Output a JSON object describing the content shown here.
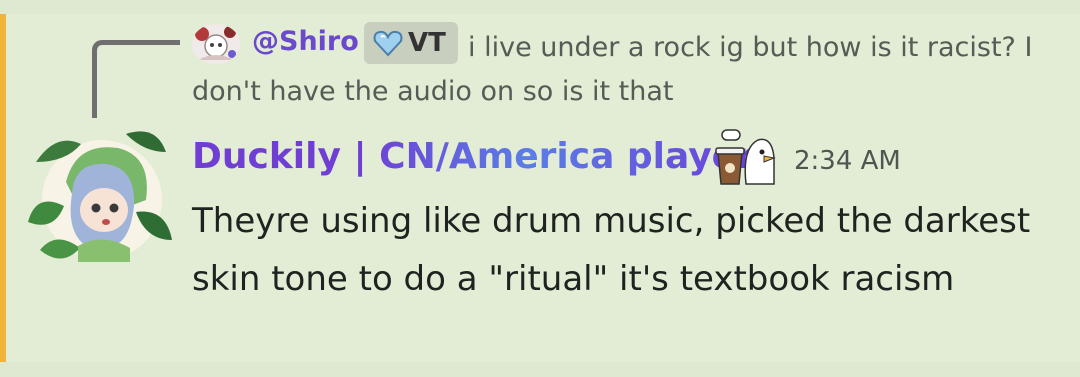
{
  "reply": {
    "username": "@Shiro",
    "role_tag": "VT",
    "preview_text": "i live under a rock ig but how is it racist? I don't have the audio on so is it that"
  },
  "message": {
    "author": "Duckily | CN/America player",
    "timestamp": "2:34 AM",
    "content": "Theyre using like drum music, picked the darkest skin tone to do a \"ritual\" it's textbook racism"
  },
  "colors": {
    "background": "#e3ecd5",
    "accent_bar": "#f0b33b",
    "reply_username": "#6a49cc",
    "author_gradient_start": "#6f3fd4",
    "author_gradient_mid": "#5a7ee6"
  },
  "icons": {
    "reply_avatar": "reply-avatar-image",
    "role_gem": "heart-gem-icon",
    "author_avatar": "author-avatar-image",
    "sticker": "duck-coffee-sticker"
  }
}
